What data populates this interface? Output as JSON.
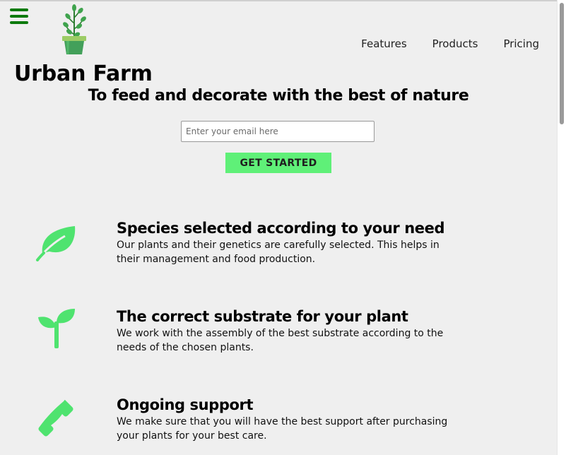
{
  "header": {
    "brand": "Urban Farm",
    "nav": [
      "Features",
      "Products",
      "Pricing"
    ]
  },
  "hero": {
    "tagline": "To feed and decorate with the best of nature",
    "email_placeholder": "Enter your email here",
    "cta_label": "GET STARTED"
  },
  "features": [
    {
      "icon": "leaf-icon",
      "title": "Species selected according to your need",
      "text": "Our plants and their genetics are carefully selected. This helps in their management and food production."
    },
    {
      "icon": "seedling-icon",
      "title": "The correct substrate for your plant",
      "text": "We work with the assembly of the best substrate according to the needs of the chosen plants."
    },
    {
      "icon": "phone-icon",
      "title": "Ongoing support",
      "text": "We make sure that you will have the best support after purchasing your plants for your best care."
    }
  ],
  "colors": {
    "accent": "#5ff078",
    "menu": "#0c7a0c",
    "icon": "#4fe36f"
  }
}
